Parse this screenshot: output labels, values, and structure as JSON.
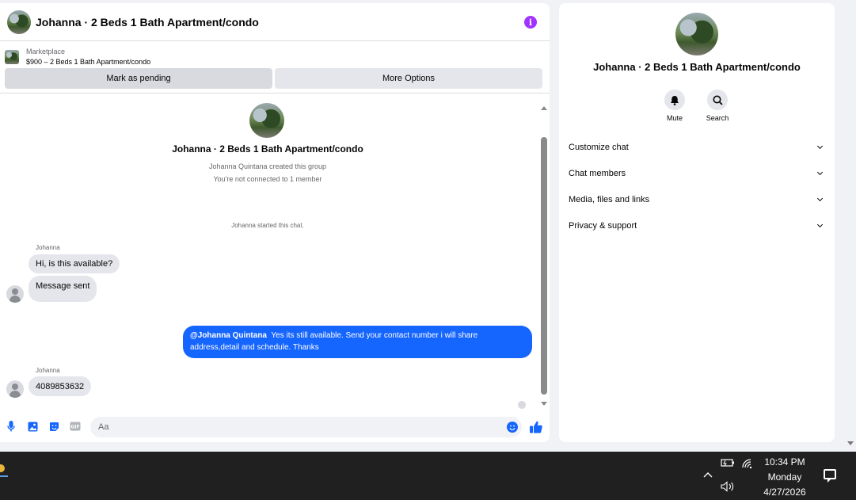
{
  "chat": {
    "header_title": "Johanna · 2 Beds 1 Bath Apartment/condo",
    "marketplace_label": "Marketplace",
    "listing": "$900 – 2 Beds 1 Bath Apartment/condo",
    "actions": {
      "pending": "Mark as pending",
      "more": "More Options"
    },
    "group": {
      "title": "Johanna · 2 Beds 1 Bath Apartment/condo",
      "created": "Johanna Quintana created this group",
      "connection": "You're not connected to 1 member"
    },
    "started": "Johanna started this chat.",
    "messages": [
      {
        "sender": "Johanna",
        "text": "Hi, is this available?"
      },
      {
        "text": "Message sent"
      },
      {
        "mention": "@Johanna Quintana",
        "text": "Yes its still available. Send your contact number i will share address,detail and schedule. Thanks"
      },
      {
        "sender": "Johanna",
        "text": "4089853632"
      }
    ],
    "composer_placeholder": "Aa"
  },
  "info": {
    "title": "Johanna · 2 Beds 1 Bath Apartment/condo",
    "mute": "Mute",
    "search": "Search",
    "sections": [
      "Customize chat",
      "Chat members",
      "Media, files and links",
      "Privacy & support"
    ]
  },
  "taskbar": {
    "time": "10:34 PM",
    "day": "Monday",
    "date": "4/27/2026"
  },
  "colors": {
    "accent": "#1565ff",
    "info_purple": "#a033ff",
    "bubble_in": "#e4e6eb"
  }
}
